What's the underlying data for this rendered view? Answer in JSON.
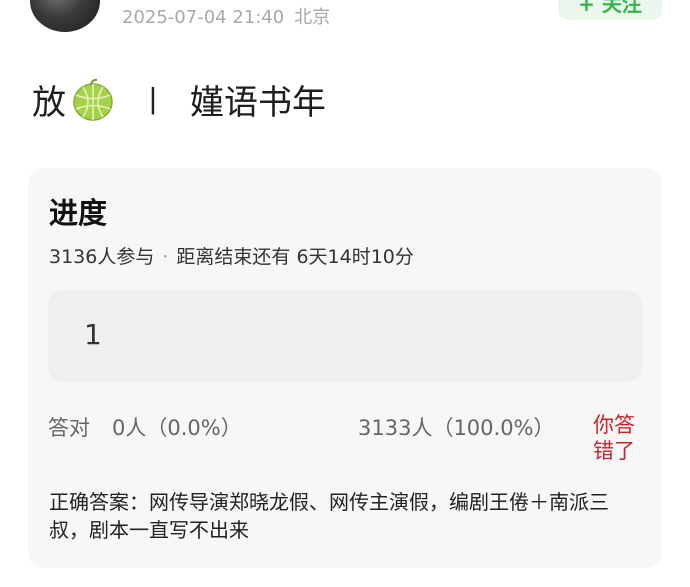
{
  "post": {
    "timestamp": "2025-07-04 21:40",
    "location": "北京",
    "follow_label": "+ 关注",
    "title_prefix": "放",
    "title_separator": "丨",
    "title_suffix": "嫤语书年",
    "emoji_icon": "melon-icon"
  },
  "poll": {
    "title": "进度",
    "participants": "3136人参与",
    "separator": "·",
    "remaining": "距离结束还有 6天14时10分",
    "option_text": "1",
    "correct_label": "答对",
    "correct_value": "0人（0.0%）",
    "wrong_value": "3133人（100.0%）",
    "your_status": "你答错了",
    "answer": "正确答案：网传导演郑晓龙假、网传主演假，编剧王倦＋南派三叔，剧本一直写不出来"
  },
  "colors": {
    "accent_green": "#38b24b",
    "wrong_red": "#c7242b",
    "card_bg": "#f7f7f7"
  }
}
